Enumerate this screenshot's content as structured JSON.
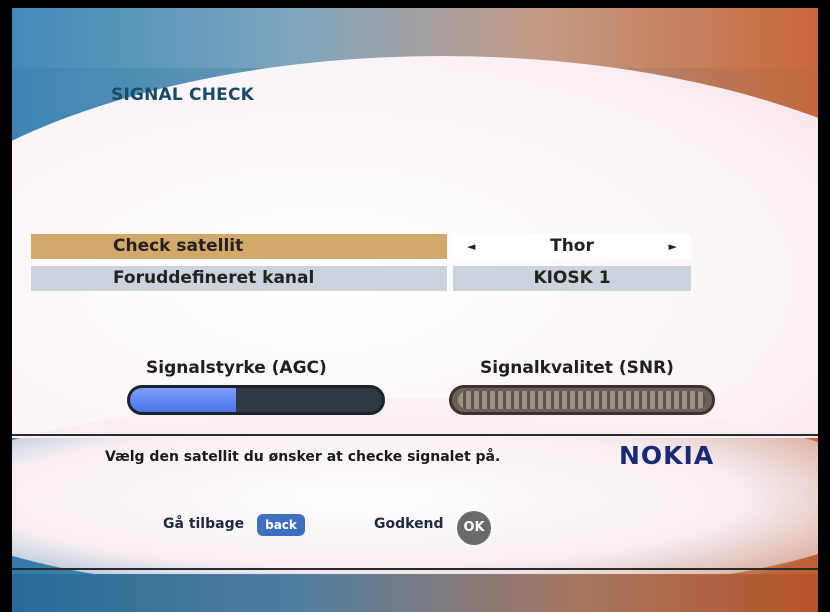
{
  "screen": {
    "title": "SIGNAL CHECK",
    "brand": "NOKIA"
  },
  "settings": {
    "satellite": {
      "label": "Check satellit",
      "value": "Thor",
      "left_arrow": "◄",
      "right_arrow": "►"
    },
    "channel": {
      "label": "Foruddefineret kanal",
      "value": "KIOSK 1"
    }
  },
  "meters": {
    "agc": {
      "label": "Signalstyrke (AGC)",
      "level_fraction": 0.42,
      "color": "#5b82f2"
    },
    "snr": {
      "label": "Signalkvalitet (SNR)",
      "level_fraction": 1.0,
      "color": "#9a9189"
    }
  },
  "hint": "Vælg den satellit du ønsker at checke signalet på.",
  "footer": {
    "back_label": "Gå tilbage",
    "back_button": "back",
    "ok_label": "Godkend",
    "ok_button": "OK"
  },
  "colors": {
    "selected_row": "#d2a96a",
    "normal_row": "#cbd3dc",
    "brand": "#1a2a78"
  }
}
